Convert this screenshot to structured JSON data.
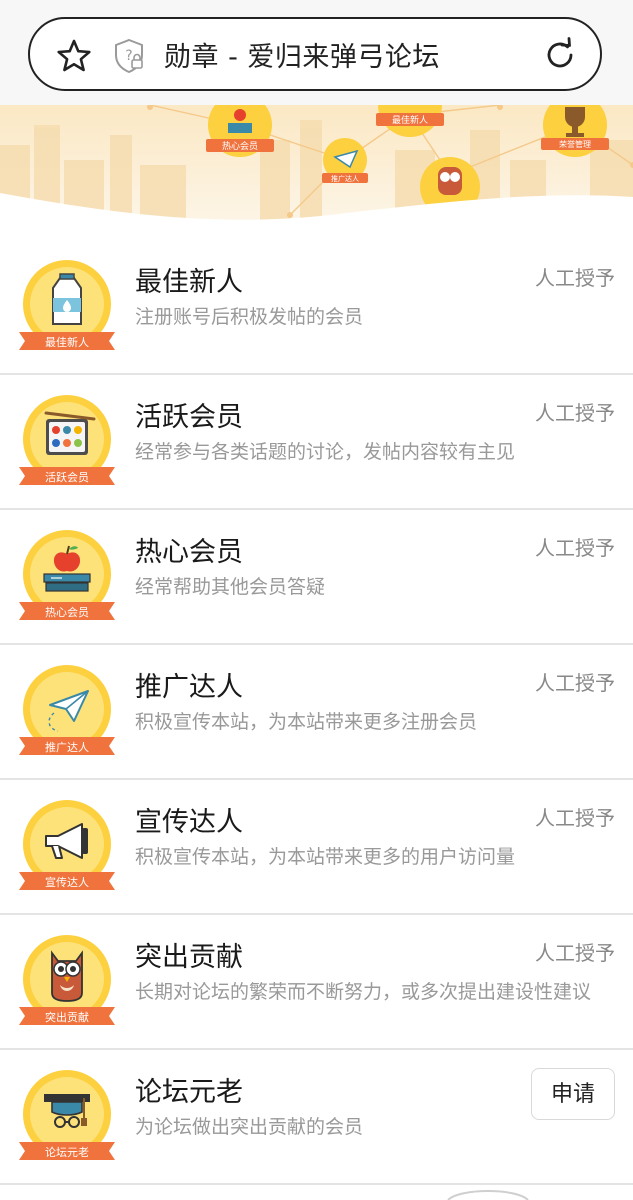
{
  "browser": {
    "title": "勋章 - 爱归来弹弓论坛"
  },
  "banner": {
    "badges": [
      "热心会员",
      "最佳新人",
      "推广达人",
      "荣誉管理"
    ]
  },
  "medals": [
    {
      "name": "最佳新人",
      "desc": "注册账号后积极发帖的会员",
      "action": "人工授予",
      "badge_label": "最佳新人",
      "icon": "milk-carton-icon"
    },
    {
      "name": "活跃会员",
      "desc": "经常参与各类话题的讨论，发帖内容较有主见",
      "action": "人工授予",
      "badge_label": "活跃会员",
      "icon": "palette-icon"
    },
    {
      "name": "热心会员",
      "desc": "经常帮助其他会员答疑",
      "action": "人工授予",
      "badge_label": "热心会员",
      "icon": "apple-books-icon"
    },
    {
      "name": "推广达人",
      "desc": "积极宣传本站，为本站带来更多注册会员",
      "action": "人工授予",
      "badge_label": "推广达人",
      "icon": "paper-plane-icon"
    },
    {
      "name": "宣传达人",
      "desc": "积极宣传本站，为本站带来更多的用户访问量",
      "action": "人工授予",
      "badge_label": "宣传达人",
      "icon": "megaphone-icon"
    },
    {
      "name": "突出贡献",
      "desc": "长期对论坛的繁荣而不断努力，或多次提出建设性建议",
      "action": "人工授予",
      "badge_label": "突出贡献",
      "icon": "owl-icon"
    },
    {
      "name": "论坛元老",
      "desc": "为论坛做出突出贡献的会员",
      "action": "申请",
      "badge_label": "论坛元老",
      "icon": "graduation-cap-icon"
    }
  ],
  "colors": {
    "badge_yellow": "#fcd03e",
    "ribbon": "#f0733e",
    "banner_bg": "#fdf3df"
  }
}
